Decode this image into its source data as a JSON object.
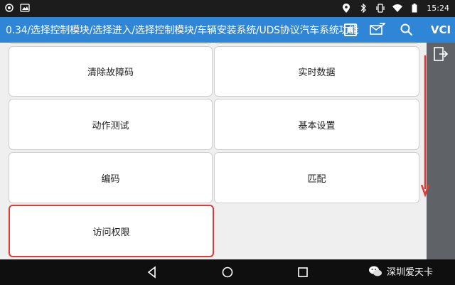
{
  "status_bar": {
    "time": "15:24",
    "left_icons": [
      "app-circle-icon",
      "image-icon"
    ],
    "right_icons": [
      "location-icon",
      "bluetooth-icon",
      "vibrate-icon",
      "wifi-icon",
      "battery-icon"
    ]
  },
  "header": {
    "title": "0.34/选择控制模块/选择进入/选择控制模块/车辆安装系统/UDS协议汽车系统功能",
    "r_badge": "R",
    "icons": [
      "mail-arrow-icon",
      "search-icon"
    ]
  },
  "side_panel": {
    "vci_label": "VCI",
    "exit_icon": "exit-icon"
  },
  "grid": {
    "tiles": [
      {
        "label": ""
      },
      {
        "label": ""
      },
      {
        "label": "清除故障码"
      },
      {
        "label": "实时数据"
      },
      {
        "label": "动作测试"
      },
      {
        "label": "基本设置"
      },
      {
        "label": "编码"
      },
      {
        "label": "匹配"
      },
      {
        "label": "访问权限"
      }
    ]
  },
  "annotation": {
    "arrow_color": "#e53935",
    "highlight_color": "#e53935"
  },
  "nav_bar": {
    "icons": [
      "back-icon",
      "home-icon",
      "recents-icon"
    ]
  },
  "watermark": {
    "text": "深圳爱天卡",
    "icon": "wechat-icon"
  },
  "colors": {
    "header": "#2f86d6",
    "side_panel": "#5f6266",
    "content_bg": "#efefef"
  }
}
